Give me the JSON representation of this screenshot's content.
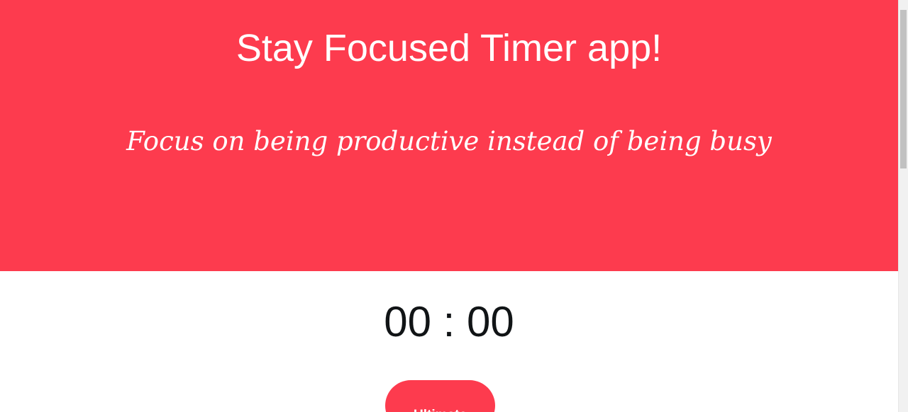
{
  "header": {
    "title": "Stay Focused Timer app!",
    "tagline": "Focus on being productive instead of being busy",
    "background_color": "#fd3b4e"
  },
  "timer": {
    "display": "00 : 00"
  },
  "mode_button": {
    "label": "Ultimate"
  },
  "colors": {
    "accent": "#fd3b4e",
    "timer_text": "#111416",
    "scrollbar_thumb": "#c1c1c1"
  }
}
